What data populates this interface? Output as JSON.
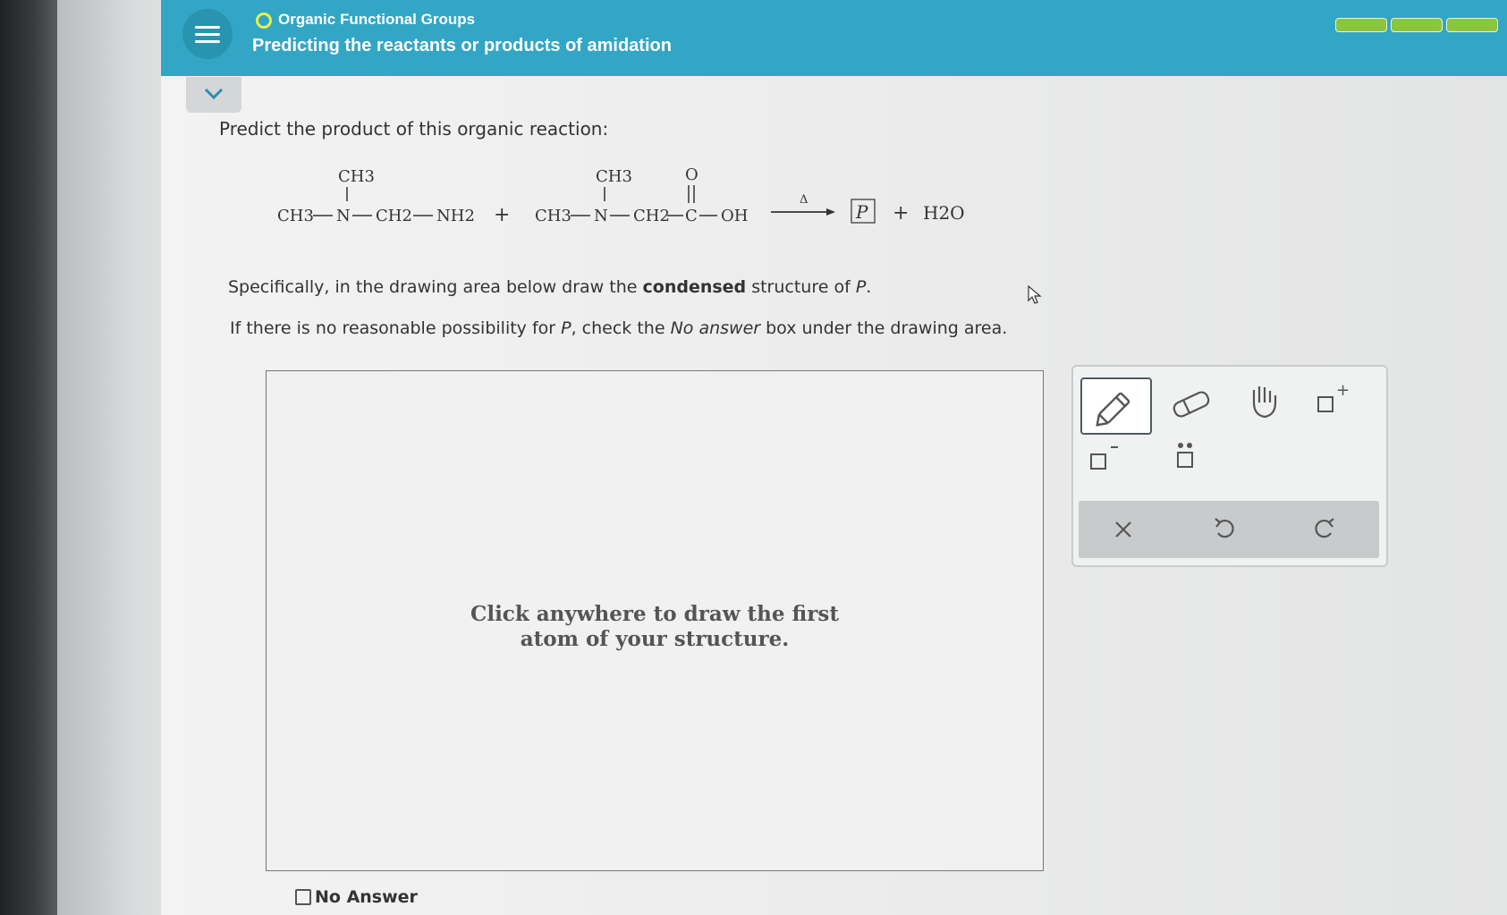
{
  "header": {
    "topic": "Organic Functional Groups",
    "subtitle": "Predicting the reactants or products of amidation"
  },
  "question": {
    "prompt": "Predict the product of this organic reaction:",
    "reaction": {
      "reactant1_top": "CH3",
      "reactant1_main": [
        "CH3",
        "N",
        "CH2",
        "NH2"
      ],
      "plus1": "+",
      "reactant2_top_methyl": "CH3",
      "reactant2_top_oxygen": "O",
      "reactant2_main": [
        "CH3",
        "N",
        "CH2",
        "C",
        "OH"
      ],
      "arrow_label": "Δ",
      "product_box": "P",
      "plus2": "+",
      "water": "H2O"
    },
    "instruction_pre": "Specifically, in the drawing area below draw the ",
    "instruction_bold": "condensed",
    "instruction_post": " structure of ",
    "instruction_var": "P",
    "instruction_end": ".",
    "noanswer_pre": "If there is no reasonable possibility for ",
    "noanswer_var": "P",
    "noanswer_mid": ", check the ",
    "noanswer_em": "No answer",
    "noanswer_post": " box under the drawing area."
  },
  "canvas": {
    "hint_line1": "Click anywhere to draw the first",
    "hint_line2": "atom of your structure."
  },
  "no_answer_label": "No Answer",
  "progress": {
    "segments_filled": 3
  },
  "colors": {
    "header": "#32a6c4",
    "progress": "#8bc53f",
    "topic_dot": "#e8f14a"
  },
  "toolbar": {
    "tools": [
      "pencil-icon",
      "eraser-icon",
      "hand-icon",
      "add-charge-icon",
      "remove-charge-icon",
      "lone-pair-icon"
    ],
    "actions": [
      "clear-icon",
      "undo-icon",
      "redo-icon"
    ]
  }
}
